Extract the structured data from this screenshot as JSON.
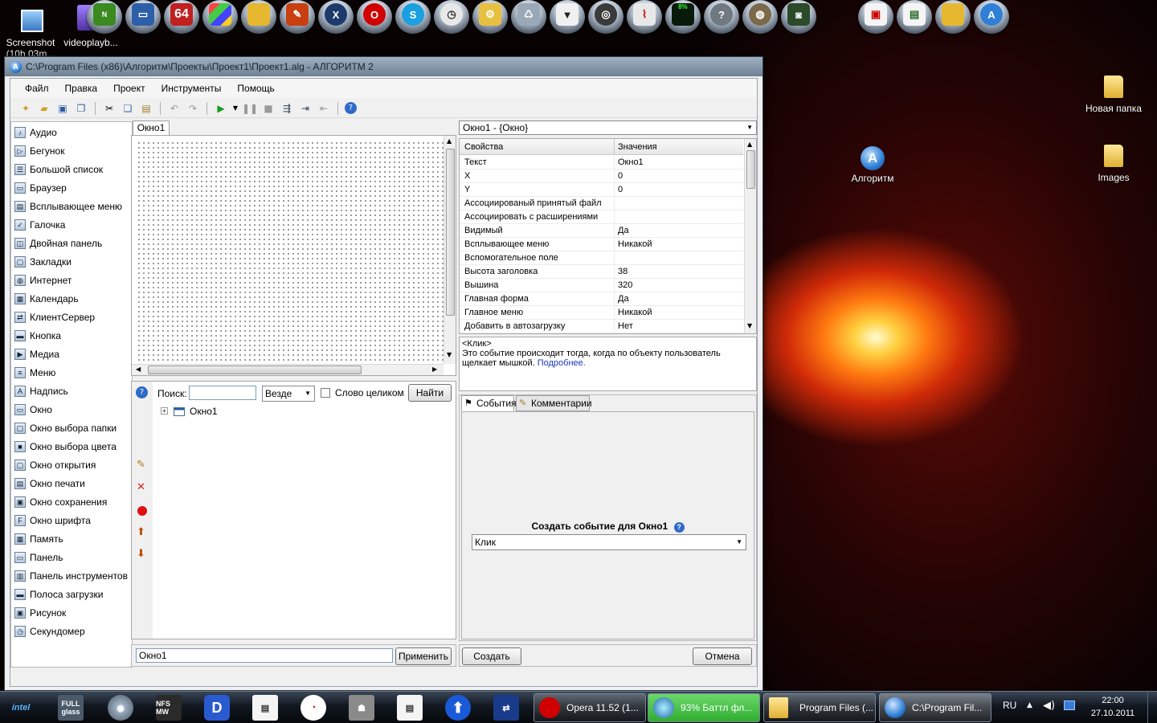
{
  "desktop": {
    "top_left_icons": [
      {
        "label": "Screenshot (10h 03m...",
        "name": "screenshot"
      },
      {
        "label": "videoplayb...",
        "name": "videoplayback"
      }
    ],
    "dock_badges": {
      "ie64": "64",
      "cpu": "8%"
    },
    "right_icons": [
      {
        "label": "Новая папка",
        "name": "new-folder"
      },
      {
        "label": "Алгоритм",
        "name": "algoritm"
      },
      {
        "label": "Images",
        "name": "images"
      }
    ]
  },
  "window": {
    "title": "C:\\Program Files (x86)\\Алгоритм\\Проекты\\Проект1\\Проект1.alg - АЛГОРИТМ 2",
    "menu": [
      "Файл",
      "Правка",
      "Проект",
      "Инструменты",
      "Помощь"
    ]
  },
  "palette": {
    "items": [
      {
        "label": "Аудио",
        "icon": "speaker-icon"
      },
      {
        "label": "Бегунок",
        "icon": "slider-icon"
      },
      {
        "label": "Большой список",
        "icon": "list-icon"
      },
      {
        "label": "Браузер",
        "icon": "browser-icon"
      },
      {
        "label": "Всплывающее меню",
        "icon": "popup-menu-icon"
      },
      {
        "label": "Галочка",
        "icon": "checkbox-icon"
      },
      {
        "label": "Двойная панель",
        "icon": "split-panel-icon"
      },
      {
        "label": "Закладки",
        "icon": "folder-tabs-icon"
      },
      {
        "label": "Интернет",
        "icon": "globe-icon"
      },
      {
        "label": "Календарь",
        "icon": "calendar-icon"
      },
      {
        "label": "КлиентСервер",
        "icon": "network-icon"
      },
      {
        "label": "Кнопка",
        "icon": "button-icon"
      },
      {
        "label": "Медиа",
        "icon": "media-icon"
      },
      {
        "label": "Меню",
        "icon": "menu-icon"
      },
      {
        "label": "Надпись",
        "icon": "label-icon"
      },
      {
        "label": "Окно",
        "icon": "window-icon"
      },
      {
        "label": "Окно выбора папки",
        "icon": "folder-dialog-icon"
      },
      {
        "label": "Окно выбора цвета",
        "icon": "color-dialog-icon"
      },
      {
        "label": "Окно открытия",
        "icon": "open-dialog-icon"
      },
      {
        "label": "Окно печати",
        "icon": "print-dialog-icon"
      },
      {
        "label": "Окно сохранения",
        "icon": "save-dialog-icon"
      },
      {
        "label": "Окно шрифта",
        "icon": "font-dialog-icon"
      },
      {
        "label": "Память",
        "icon": "memory-icon"
      },
      {
        "label": "Панель",
        "icon": "panel-icon"
      },
      {
        "label": "Панель инструментов",
        "icon": "toolbar-icon"
      },
      {
        "label": "Полоса загрузки",
        "icon": "progressbar-icon"
      },
      {
        "label": "Рисунок",
        "icon": "image-icon"
      },
      {
        "label": "Секундомер",
        "icon": "stopwatch-icon"
      }
    ]
  },
  "designer": {
    "tab": "Окно1"
  },
  "search": {
    "label": "Поиск:",
    "value": "",
    "scope": "Везде",
    "whole_word": "Слово целиком",
    "find": "Найти"
  },
  "tree": {
    "root": "Окно1"
  },
  "name_field": {
    "value": "Окно1",
    "apply": "Применить"
  },
  "properties": {
    "object": "Окно1 - {Окно}",
    "col_name": "Свойства",
    "col_value": "Значения",
    "rows": [
      {
        "name": "Текст",
        "value": "Окно1"
      },
      {
        "name": "X",
        "value": "0"
      },
      {
        "name": "Y",
        "value": "0"
      },
      {
        "name": "Ассоциированый принятый файл",
        "value": ""
      },
      {
        "name": "Ассоциировать с расширениями",
        "value": ""
      },
      {
        "name": "Видимый",
        "value": "Да"
      },
      {
        "name": "Всплывающее меню",
        "value": "Никакой"
      },
      {
        "name": "Вспомогательное поле",
        "value": ""
      },
      {
        "name": "Высота заголовка",
        "value": "38"
      },
      {
        "name": "Вышина",
        "value": "320"
      },
      {
        "name": "Главная форма",
        "value": "Да"
      },
      {
        "name": "Главное меню",
        "value": "Никакой"
      },
      {
        "name": "Добавить в автозагрузку",
        "value": "Нет"
      }
    ]
  },
  "event_desc": {
    "title": "<Клик>",
    "text": "Это событие происходит тогда, когда по объекту пользователь щелкает мышкой.",
    "link": "Подробнее."
  },
  "events": {
    "tabs": [
      "События",
      "Комментарии"
    ],
    "create_label": "Создать событие для Окно1",
    "selected": "Клик",
    "create_btn": "Создать",
    "cancel_btn": "Отмена"
  },
  "taskbar": {
    "items": [
      {
        "label": "Opera 11.52 (1...",
        "name": "opera"
      },
      {
        "label": "93% Баттл фл...",
        "name": "download"
      },
      {
        "label": "Program Files (...",
        "name": "explorer"
      },
      {
        "label": "C:\\Program Fil...",
        "name": "algoritm"
      }
    ],
    "lang": "RU",
    "time": "22:00",
    "date": "27.10.2011",
    "quicklaunch_text": {
      "intel": "intel",
      "fullglass": "FULL glass",
      "nfs": "NFS MW"
    }
  },
  "colors": {
    "accent": "#2f7fd6",
    "download_green": "#2fae2f",
    "opera_red": "#d00000"
  }
}
